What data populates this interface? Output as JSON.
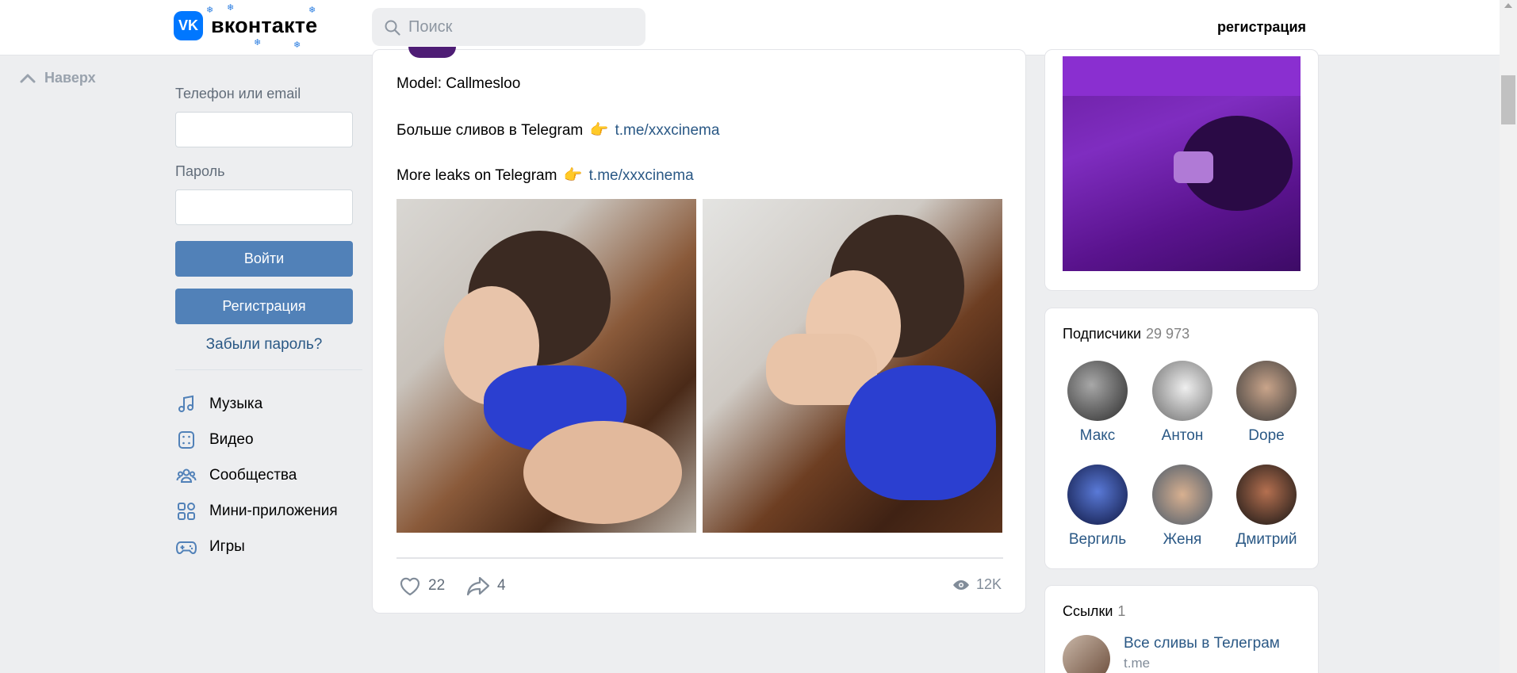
{
  "header": {
    "logo_mark": "VK",
    "logo_text": "вконтакте",
    "search_placeholder": "Поиск",
    "register_label": "регистрация"
  },
  "to_top": {
    "label": "Наверх"
  },
  "login": {
    "phone_label": "Телефон или email",
    "password_label": "Пароль",
    "login_button": "Войти",
    "register_button": "Регистрация",
    "forgot_link": "Забыли пароль?"
  },
  "menu": [
    {
      "label": "Музыка",
      "icon": "music-icon"
    },
    {
      "label": "Видео",
      "icon": "video-icon"
    },
    {
      "label": "Сообщества",
      "icon": "communities-icon"
    },
    {
      "label": "Мини-приложения",
      "icon": "mini-apps-icon"
    },
    {
      "label": "Игры",
      "icon": "games-icon"
    }
  ],
  "post": {
    "line1": "Model: Callmesloo",
    "line2_text": "Больше сливов в Telegram",
    "line2_link": "t.me/xxxcinema",
    "line3_text": "More leaks on Telegram",
    "line3_link": "t.me/xxxcinema",
    "hand_emoji": "👉",
    "likes": "22",
    "shares": "4",
    "views": "12K"
  },
  "subscribers": {
    "title": "Подписчики",
    "count": "29 973",
    "items": [
      {
        "name": "Макс"
      },
      {
        "name": "Антон"
      },
      {
        "name": "Dope"
      },
      {
        "name": "Вергиль"
      },
      {
        "name": "Женя"
      },
      {
        "name": "Дмитрий"
      }
    ]
  },
  "links": {
    "title": "Ссылки",
    "count": "1",
    "items": [
      {
        "title": "Все сливы в Телеграм",
        "url": "t.me"
      }
    ]
  },
  "colors": {
    "accent": "#5181b8",
    "link": "#2a5885",
    "brand": "#0077ff",
    "background": "#edeef0"
  }
}
